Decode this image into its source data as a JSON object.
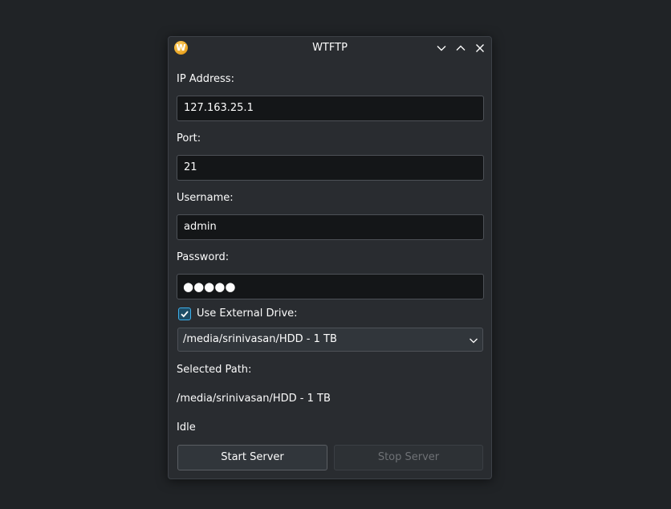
{
  "window": {
    "title": "WTFTP",
    "app_icon_letter": "W",
    "controls": [
      "minimize-icon",
      "maximize-icon",
      "close-icon"
    ]
  },
  "form": {
    "ip_label": "IP Address:",
    "ip_value": "127.163.25.1",
    "port_label": "Port:",
    "port_value": "21",
    "username_label": "Username:",
    "username_value": "admin",
    "password_label": "Password:",
    "password_masked": "●●●●●",
    "external_drive_label": "Use External Drive:",
    "external_drive_checked": true,
    "drive_selected": "/media/srinivasan/HDD - 1 TB",
    "selected_path_label": "Selected Path:",
    "selected_path_value": "/media/srinivasan/HDD - 1 TB",
    "status": "Idle"
  },
  "buttons": {
    "start_label": "Start Server",
    "stop_label": "Stop Server",
    "stop_enabled": false
  },
  "colors": {
    "background": "#202326",
    "window": "#292c30",
    "input_bg": "#141618",
    "accent": "#3daee9",
    "icon": "#e8a21f"
  }
}
